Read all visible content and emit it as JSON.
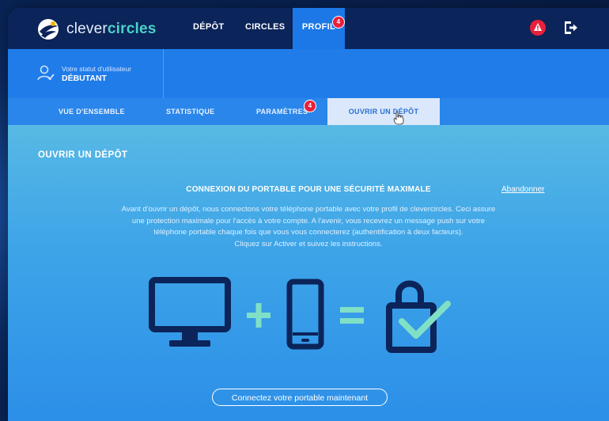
{
  "brand": {
    "light": "clever",
    "bold": "circles"
  },
  "nav": {
    "items": [
      {
        "label": "DÉPÔT"
      },
      {
        "label": "CIRCLES"
      },
      {
        "label": "PROFIL",
        "badge": "4"
      }
    ],
    "notification_icon": "alert-icon",
    "logout_icon": "logout-icon"
  },
  "status": {
    "label": "Votre statut d'utilisateur",
    "value": "DÉBUTANT",
    "icon": "user-check-icon"
  },
  "subnav": {
    "items": [
      {
        "label": "VUE D'ENSEMBLE"
      },
      {
        "label": "STATISTIQUE"
      },
      {
        "label": "PARAMÈTRES",
        "badge": "4"
      },
      {
        "label": "OUVRIR UN DÉPÔT"
      }
    ]
  },
  "main": {
    "title": "OUVRIR UN DÉPÔT",
    "heading": "CONNEXION DU PORTABLE POUR UNE SÉCURITÉ MAXIMALE",
    "abandon": "Abandonner",
    "description_lines": [
      "Avant d'ouvrir un dépôt, nous connectons votre téléphone portable avec votre profil de clevercircles. Ceci assure",
      "une protection maximale pour l'accès à votre compte. A l'avenir, vous recevrez un message push sur votre",
      "téléphone portable chaque fois que vous vous connecterez (authentification à deux facteurs).",
      "Cliquez sur Activer et suivez les instructions."
    ],
    "illustration_icons": [
      "monitor-icon",
      "plus-icon",
      "mobile-phone-icon",
      "equals-icon",
      "padlock-check-icon"
    ],
    "connect_button": "Connectez votre portable maintenant"
  },
  "colors": {
    "nav_bg": "#0b2459",
    "accent": "#1b78e6",
    "teal": "#4ad3c8",
    "badge": "#e9203a",
    "icon_dark": "#0b2459"
  }
}
